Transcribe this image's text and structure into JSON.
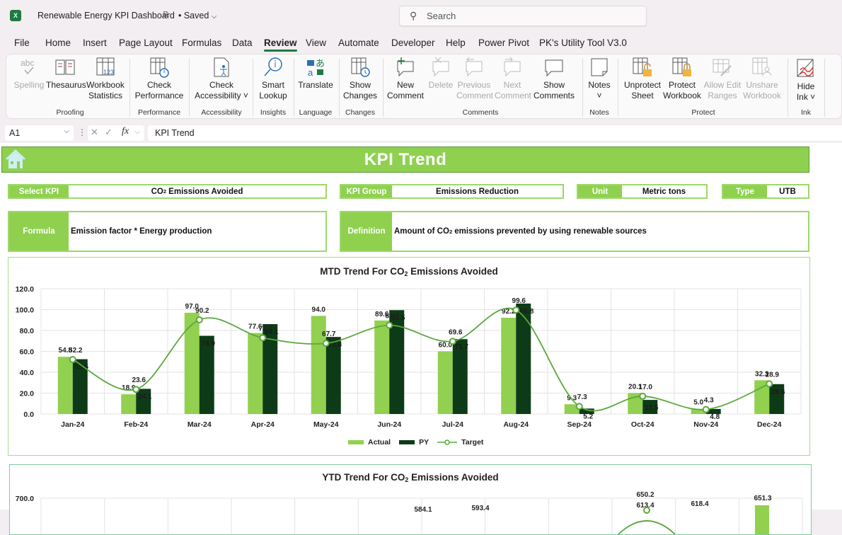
{
  "app": {
    "title": "Renewable Energy KPI Dashboard",
    "save_status": "• Saved",
    "search_placeholder": "Search"
  },
  "menu": [
    {
      "label": "File"
    },
    {
      "label": "Home"
    },
    {
      "label": "Insert"
    },
    {
      "label": "Page Layout"
    },
    {
      "label": "Formulas"
    },
    {
      "label": "Data"
    },
    {
      "label": "Review",
      "active": true
    },
    {
      "label": "View"
    },
    {
      "label": "Automate"
    },
    {
      "label": "Developer"
    },
    {
      "label": "Help"
    },
    {
      "label": "Power Pivot"
    },
    {
      "label": "PK's Utility Tool V3.0"
    }
  ],
  "ribbon": {
    "buttons": {
      "spelling": {
        "line1": "Spelling",
        "line2": "",
        "disabled": true
      },
      "thesaurus": {
        "line1": "Thesaurus",
        "line2": ""
      },
      "workbook_statistics": {
        "line1": "Workbook",
        "line2": "Statistics"
      },
      "check_performance": {
        "line1": "Check",
        "line2": "Performance"
      },
      "check_accessibility": {
        "line1": "Check",
        "line2": "Accessibility ˅"
      },
      "smart_lookup": {
        "line1": "Smart",
        "line2": "Lookup"
      },
      "translate": {
        "line1": "Translate",
        "line2": ""
      },
      "show_changes": {
        "line1": "Show",
        "line2": "Changes"
      },
      "new_comment": {
        "line1": "New",
        "line2": "Comment"
      },
      "delete": {
        "line1": "Delete",
        "line2": "",
        "disabled": true
      },
      "previous_comment": {
        "line1": "Previous",
        "line2": "Comment",
        "disabled": true
      },
      "next_comment": {
        "line1": "Next",
        "line2": "Comment",
        "disabled": true
      },
      "show_comments": {
        "line1": "Show",
        "line2": "Comments"
      },
      "notes": {
        "line1": "Notes",
        "line2": "˅"
      },
      "unprotect_sheet": {
        "line1": "Unprotect",
        "line2": "Sheet"
      },
      "protect_workbook": {
        "line1": "Protect",
        "line2": "Workbook"
      },
      "allow_edit_ranges": {
        "line1": "Allow Edit",
        "line2": "Ranges",
        "disabled": true
      },
      "unshare_workbook": {
        "line1": "Unshare",
        "line2": "Workbook",
        "disabled": true
      },
      "hide_ink": {
        "line1": "Hide",
        "line2": "Ink ˅"
      }
    },
    "groups": {
      "proofing": "Proofing",
      "performance": "Performance",
      "accessibility": "Accessibility",
      "insights": "Insights",
      "language": "Language",
      "changes": "Changes",
      "comments": "Comments",
      "notes": "Notes",
      "protect": "Protect",
      "ink": "Ink"
    }
  },
  "formula_bar": {
    "cell_ref": "A1",
    "fx_label": "fx",
    "content": "KPI Trend"
  },
  "dashboard": {
    "title": "KPI Trend",
    "select_kpi": {
      "label": "Select KPI",
      "value_prefix": "CO",
      "value_sub": "2",
      "value_suffix": " Emissions Avoided"
    },
    "kpi_group": {
      "label": "KPI Group",
      "value": "Emissions Reduction"
    },
    "unit": {
      "label": "Unit",
      "value": "Metric tons"
    },
    "type": {
      "label": "Type",
      "value": "UTB"
    },
    "formula": {
      "label": "Formula",
      "value": "Emission factor * Energy production"
    },
    "definition": {
      "label": "Definition",
      "value_prefix": "Amount of CO",
      "value_sub": "2",
      "value_suffix": " emissions prevented by using renewable sources"
    }
  },
  "colors": {
    "accent_green": "#8fd14f",
    "actual": "#92d050",
    "py": "#0e3b17",
    "target": "#5aa83c"
  },
  "chart_data": [
    {
      "type": "bar",
      "title_prefix": "MTD Trend For CO",
      "title_sub": "2",
      "title_suffix": " Emissions Avoided",
      "xlabel": "",
      "ylabel": "",
      "ylim": [
        0,
        120
      ],
      "yticks": [
        "0.0",
        "20.0",
        "40.0",
        "60.0",
        "80.0",
        "100.0",
        "120.0"
      ],
      "grid": true,
      "legend_position": "bottom",
      "categories": [
        "Jan-24",
        "Feb-24",
        "Mar-24",
        "Apr-24",
        "May-24",
        "Jun-24",
        "Jul-24",
        "Aug-24",
        "Sep-24",
        "Oct-24",
        "Nov-24",
        "Dec-24"
      ],
      "series": [
        {
          "name": "Actual",
          "kind": "bar",
          "values": [
            54.8,
            18.9,
            97.0,
            77.6,
            94.0,
            89.6,
            60.0,
            92.2,
            9.3,
            20.1,
            5.0,
            32.3
          ]
        },
        {
          "name": "PY",
          "kind": "bar",
          "values": [
            52.5,
            24.1,
            74.9,
            86.1,
            73.8,
            99.5,
            71.7,
            105.8,
            5.2,
            13.5,
            4.8,
            28.6
          ]
        },
        {
          "name": "Target",
          "kind": "line",
          "values": [
            52.2,
            23.6,
            90.2,
            73.0,
            67.7,
            85.0,
            69.6,
            99.6,
            7.3,
            17.0,
            4.3,
            28.9
          ]
        }
      ]
    },
    {
      "type": "bar",
      "title_prefix": "YTD Trend For CO",
      "title_sub": "2",
      "title_suffix": " Emissions Avoided",
      "yticks_visible": [
        "700.0"
      ],
      "visible_labels": [
        "584.1",
        "593.4",
        "650.2",
        "613.4",
        "618.4",
        "651.3"
      ]
    }
  ]
}
